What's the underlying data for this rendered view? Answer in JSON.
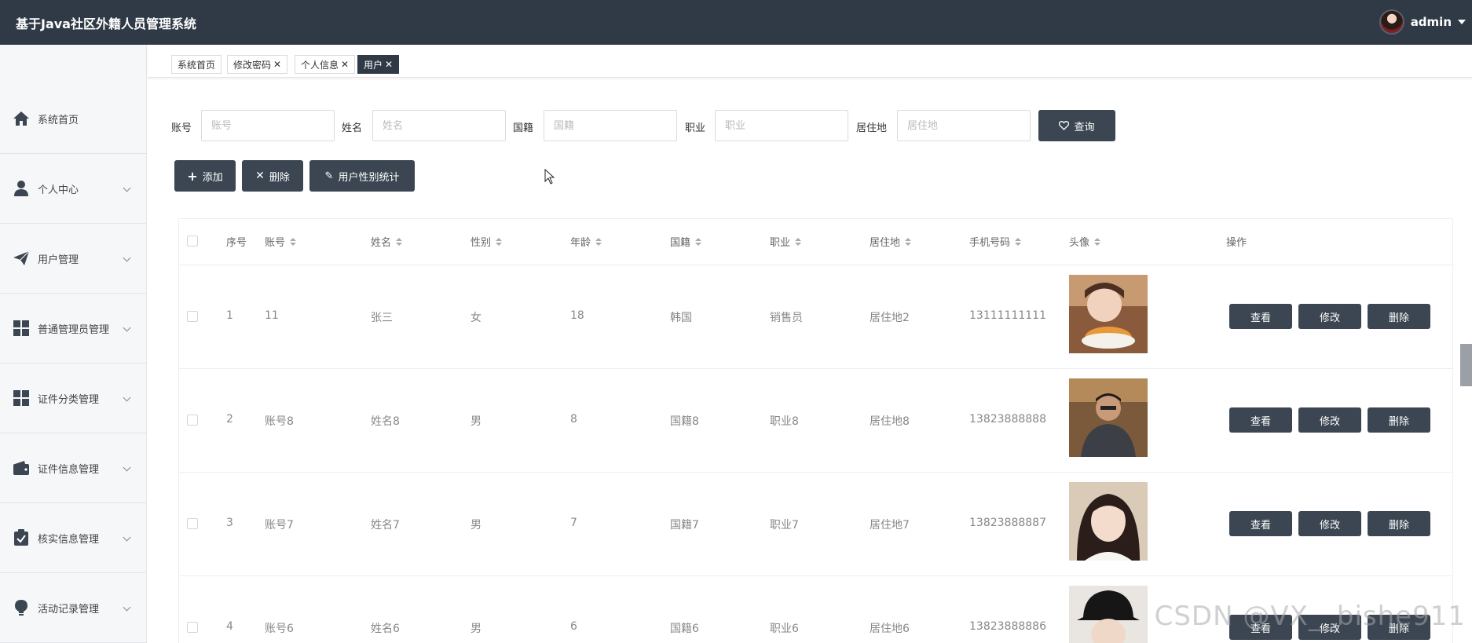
{
  "app": {
    "title": "基于Java社区外籍人员管理系统"
  },
  "user": {
    "name": "admin"
  },
  "sidebar": {
    "items": [
      {
        "label": "系统首页",
        "icon": "home-icon"
      },
      {
        "label": "个人中心",
        "icon": "person-icon"
      },
      {
        "label": "用户管理",
        "icon": "paper-plane-icon"
      },
      {
        "label": "普通管理员管理",
        "icon": "grid-icon"
      },
      {
        "label": "证件分类管理",
        "icon": "grid-icon"
      },
      {
        "label": "证件信息管理",
        "icon": "wallet-icon"
      },
      {
        "label": "核实信息管理",
        "icon": "clipboard-check-icon"
      },
      {
        "label": "活动记录管理",
        "icon": "lightbulb-icon"
      }
    ]
  },
  "tabs": [
    {
      "label": "系统首页",
      "closable": false
    },
    {
      "label": "修改密码",
      "closable": true
    },
    {
      "label": "个人信息",
      "closable": true
    },
    {
      "label": "用户",
      "closable": true,
      "active": true
    }
  ],
  "search": {
    "fields": [
      {
        "label": "账号",
        "placeholder": "账号"
      },
      {
        "label": "姓名",
        "placeholder": "姓名"
      },
      {
        "label": "国籍",
        "placeholder": "国籍"
      },
      {
        "label": "职业",
        "placeholder": "职业"
      },
      {
        "label": "居住地",
        "placeholder": "居住地"
      }
    ],
    "query_label": "查询"
  },
  "toolbar": {
    "add_label": "添加",
    "delete_label": "删除",
    "stats_label": "用户性别统计"
  },
  "table": {
    "headers": [
      "序号",
      "账号",
      "姓名",
      "性别",
      "年龄",
      "国籍",
      "职业",
      "居住地",
      "手机号码",
      "头像",
      "操作"
    ],
    "rows": [
      {
        "index": "1",
        "account": "11",
        "name": "张三",
        "gender": "女",
        "age": "18",
        "nationality": "韩国",
        "job": "销售员",
        "residence": "居住地2",
        "phone": "13111111111"
      },
      {
        "index": "2",
        "account": "账号8",
        "name": "姓名8",
        "gender": "男",
        "age": "8",
        "nationality": "国籍8",
        "job": "职业8",
        "residence": "居住地8",
        "phone": "13823888888"
      },
      {
        "index": "3",
        "account": "账号7",
        "name": "姓名7",
        "gender": "男",
        "age": "7",
        "nationality": "国籍7",
        "job": "职业7",
        "residence": "居住地7",
        "phone": "13823888887"
      },
      {
        "index": "4",
        "account": "账号6",
        "name": "姓名6",
        "gender": "男",
        "age": "6",
        "nationality": "国籍6",
        "job": "职业6",
        "residence": "居住地6",
        "phone": "13823888886"
      }
    ],
    "actions": {
      "view": "查看",
      "edit": "修改",
      "delete": "删除"
    }
  },
  "watermark": "CSDN @VX__bishe911",
  "colors": {
    "topbar": "#2f3a46",
    "button": "#3b4652",
    "sidebar_bg": "#f6f7f9"
  }
}
